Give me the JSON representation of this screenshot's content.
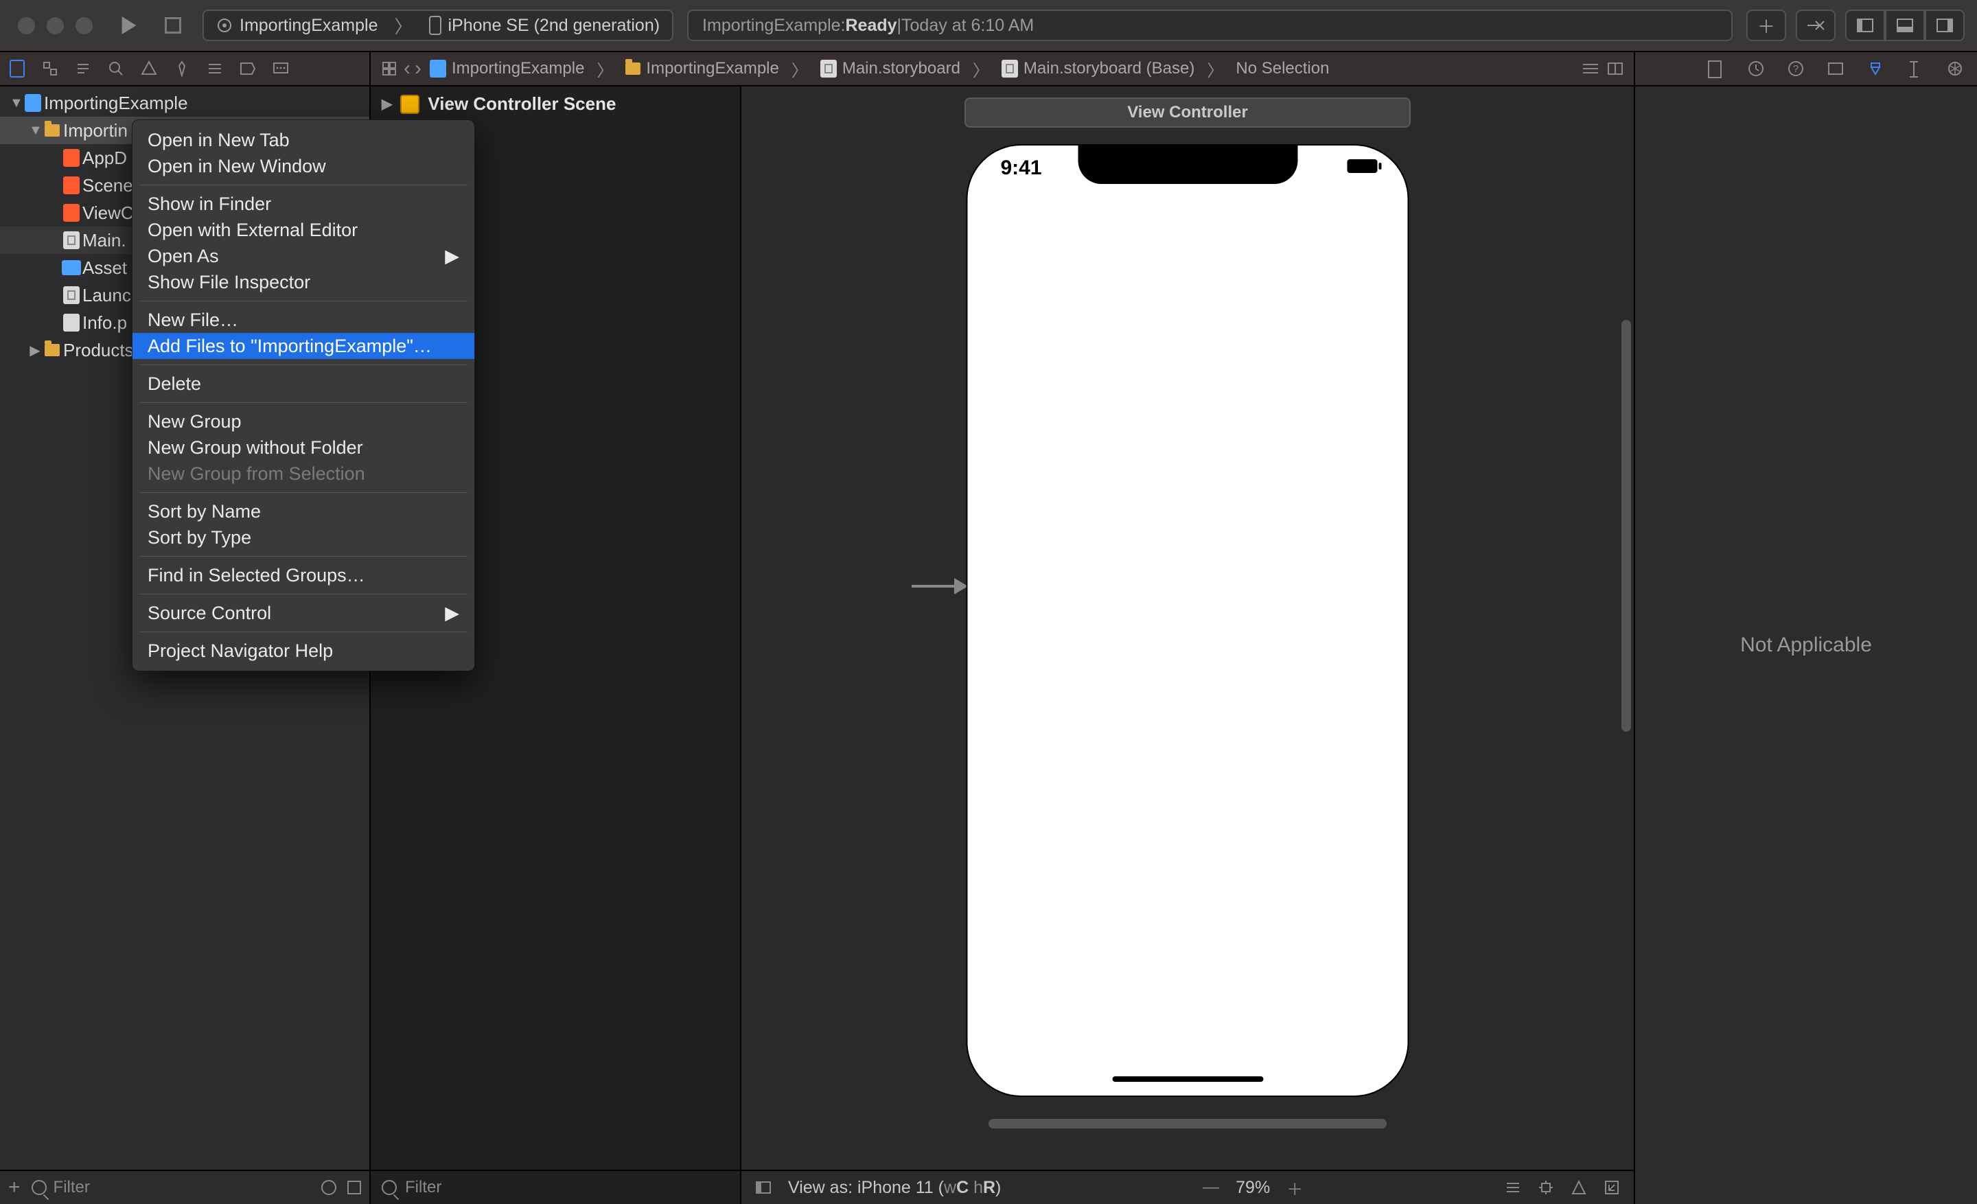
{
  "titlebar": {
    "scheme_target": "ImportingExample",
    "scheme_device": "iPhone SE (2nd generation)",
    "status_prefix": "ImportingExample: ",
    "status_state": "Ready",
    "status_sep": " | ",
    "status_time": "Today at 6:10 AM"
  },
  "jump": {
    "chev_back": "‹",
    "chev_fwd": "›",
    "crumbs": [
      "ImportingExample",
      "ImportingExample",
      "Main.storyboard",
      "Main.storyboard (Base)",
      "No Selection"
    ]
  },
  "navigator": {
    "project": "ImportingExample",
    "group": "Importin",
    "products": "Products",
    "files": [
      "AppD",
      "Scene",
      "ViewC",
      "Main.",
      "Asset",
      "Launc",
      "Info.p"
    ],
    "filter_placeholder": "Filter"
  },
  "outline": {
    "scene": "View Controller Scene",
    "filter_placeholder": "Filter"
  },
  "canvas": {
    "vc_label": "View Controller",
    "time": "9:41",
    "footer_viewas": "View as: iPhone 11 (",
    "footer_w": "w",
    "footer_c": "C ",
    "footer_h": "h",
    "footer_r": "R",
    "footer_close": ")",
    "zoom": "79%"
  },
  "inspector": {
    "placeholder": "Not Applicable"
  },
  "ctx": {
    "open_tab": "Open in New Tab",
    "open_win": "Open in New Window",
    "finder": "Show in Finder",
    "ext": "Open with External Editor",
    "open_as": "Open As",
    "file_insp": "Show File Inspector",
    "new_file": "New File…",
    "add_files": "Add Files to \"ImportingExample\"…",
    "delete": "Delete",
    "new_group": "New Group",
    "new_group_nf": "New Group without Folder",
    "new_group_sel": "New Group from Selection",
    "sort_name": "Sort by Name",
    "sort_type": "Sort by Type",
    "find_sel": "Find in Selected Groups…",
    "source_ctrl": "Source Control",
    "nav_help": "Project Navigator Help"
  }
}
